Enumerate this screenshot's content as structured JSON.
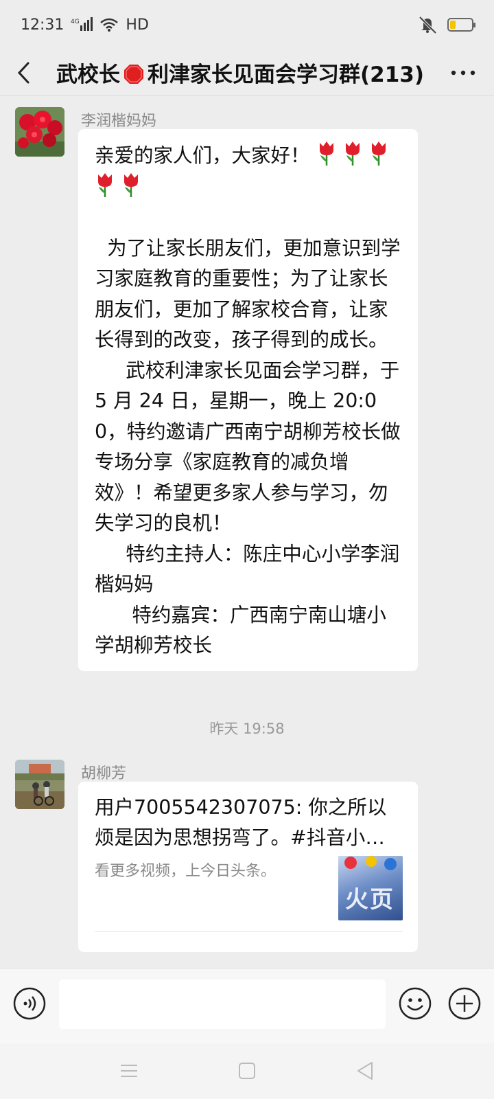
{
  "status_bar": {
    "time": "12:31",
    "network": "4G",
    "hd": "HD"
  },
  "header": {
    "title_prefix": "武校长",
    "title_suffix": "利津家长见面会学习群(213)"
  },
  "messages": [
    {
      "sender": "李润楷妈妈",
      "greeting": "亲爱的家人们，大家好！",
      "body": "  为了让家长朋友们，更加意识到学习家庭教育的重要性；为了让家长朋友们，更加了解家校合育，让家长得到的改变，孩子得到的成长。\n     武校利津家长见面会学习群，于 5 月 24 日，星期一，晚上 20:00，特约邀请广西南宁胡柳芳校长做专场分享《家庭教育的减负增效》！希望更多家人参与学习，勿失学习的良机！\n     特约主持人：陈庄中心小学李润楷妈妈\n      特约嘉宾：广西南宁南山塘小学胡柳芳校长"
    },
    {
      "sender": "胡柳芳",
      "link_title": "用户7005542307075: 你之所以烦是因为思想拐弯了。#抖音小…",
      "link_desc": "看更多视频，上今日头条。",
      "thumb_text": "火页"
    }
  ],
  "timestamp": "昨天 19:58",
  "input": {
    "value": ""
  },
  "colors": {
    "background": "#ededed",
    "bubble": "#ffffff",
    "sender": "#8a8a8a"
  }
}
